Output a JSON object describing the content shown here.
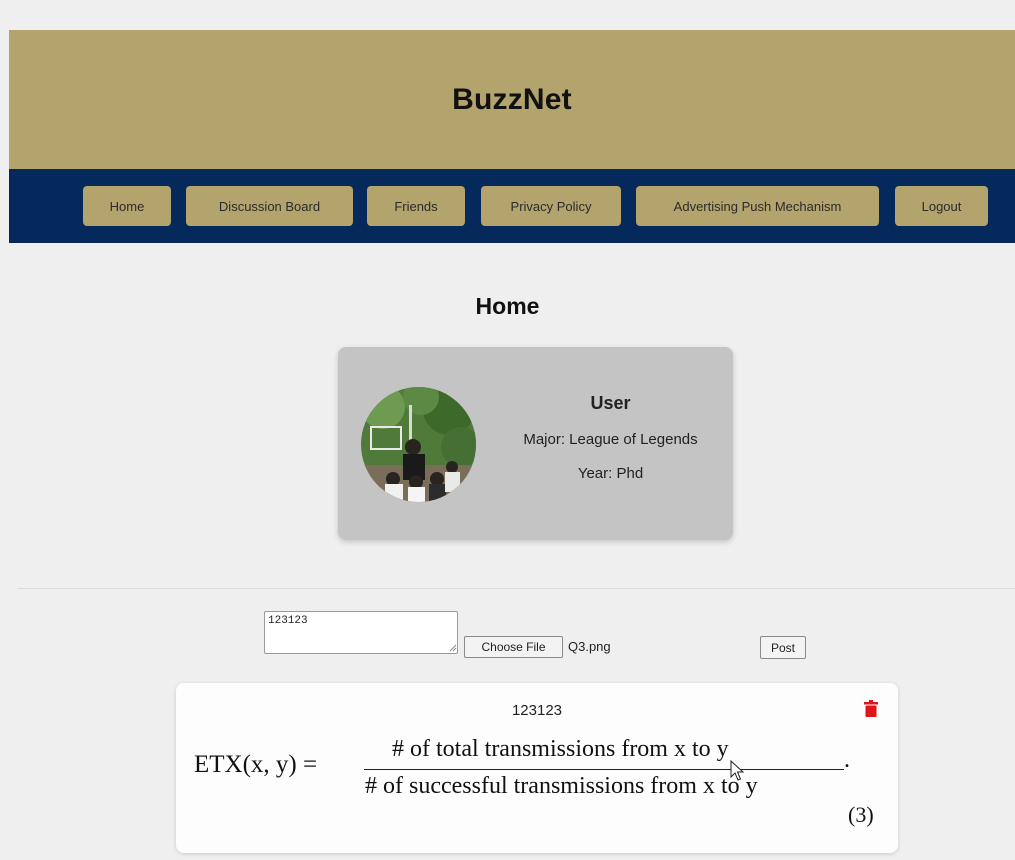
{
  "app": {
    "title": "BuzzNet"
  },
  "nav": {
    "items": [
      {
        "label": "Home"
      },
      {
        "label": "Discussion Board"
      },
      {
        "label": "Friends"
      },
      {
        "label": "Privacy Policy"
      },
      {
        "label": "Advertising Push Mechanism"
      },
      {
        "label": "Logout"
      }
    ]
  },
  "page": {
    "title": "Home"
  },
  "profile": {
    "name": "User",
    "major": "Major: League of Legends",
    "year": "Year: Phd"
  },
  "composer": {
    "text_value": "123123",
    "choose_file_label": "Choose File",
    "file_name": "Q3.png",
    "post_label": "Post"
  },
  "post": {
    "text": "123123",
    "formula": {
      "lhs": "ETX(x, y) =",
      "numerator": "# of total transmissions from x to y",
      "denominator": "# of successful transmissions from x to y",
      "equation_number": "(3)"
    }
  },
  "colors": {
    "header_bg": "#b3a36c",
    "nav_bg": "#04295a",
    "nav_button_bg": "#b3a36c",
    "profile_card_bg": "#c4c4c4",
    "trash_icon": "#e0141b"
  }
}
